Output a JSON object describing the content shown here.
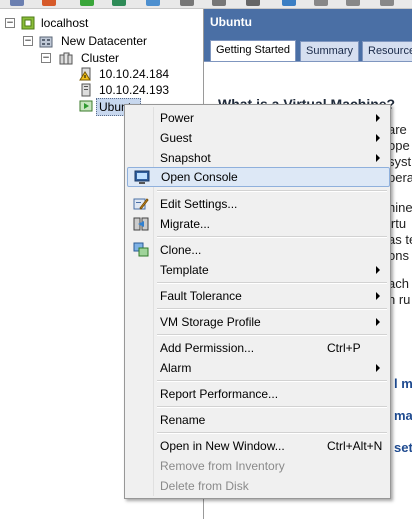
{
  "tree": {
    "root": {
      "label": "localhost",
      "expander": "−"
    },
    "datacenter": {
      "label": "New Datacenter",
      "expander": "−"
    },
    "cluster": {
      "label": "Cluster",
      "expander": "−"
    },
    "hosts": [
      {
        "label": "10.10.24.184",
        "icon": "host-warning-icon"
      },
      {
        "label": "10.10.24.193",
        "icon": "host-icon"
      }
    ],
    "vm": {
      "label": "Ubuntu",
      "icon": "vm-icon"
    }
  },
  "panel": {
    "title": "Ubuntu",
    "tabs": [
      "Getting Started",
      "Summary",
      "Resource"
    ],
    "heading": "What is a Virtual Machine?",
    "fragments": [
      "are",
      "ope",
      "syst",
      "pera",
      "hines",
      "irtu",
      "as te",
      "ons",
      "ach",
      "n ru"
    ],
    "links": [
      "l ma",
      "mac",
      "set"
    ]
  },
  "context_menu": {
    "items": [
      {
        "label": "Power",
        "submenu": true
      },
      {
        "label": "Guest",
        "submenu": true
      },
      {
        "label": "Snapshot",
        "submenu": true
      },
      {
        "label": "Open Console",
        "icon": "console-icon",
        "highlighted": true
      },
      {
        "separator": true
      },
      {
        "label": "Edit Settings...",
        "icon": "edit-settings-icon"
      },
      {
        "label": "Migrate...",
        "icon": "migrate-icon"
      },
      {
        "separator": true
      },
      {
        "label": "Clone...",
        "icon": "clone-icon"
      },
      {
        "label": "Template",
        "submenu": true
      },
      {
        "separator": true
      },
      {
        "label": "Fault Tolerance",
        "submenu": true
      },
      {
        "separator": true
      },
      {
        "label": "VM Storage Profile",
        "submenu": true
      },
      {
        "separator": true
      },
      {
        "label": "Add Permission...",
        "shortcut": "Ctrl+P"
      },
      {
        "label": "Alarm",
        "submenu": true
      },
      {
        "separator": true
      },
      {
        "label": "Report Performance..."
      },
      {
        "separator": true
      },
      {
        "label": "Rename"
      },
      {
        "separator": true
      },
      {
        "label": "Open in New Window...",
        "shortcut": "Ctrl+Alt+N"
      },
      {
        "label": "Remove from Inventory",
        "disabled": true
      },
      {
        "label": "Delete from Disk",
        "disabled": true
      }
    ]
  },
  "colors": {
    "panel_header": "#4a6fa5",
    "link": "#1e4a8f",
    "highlight": "#dde8f6"
  }
}
